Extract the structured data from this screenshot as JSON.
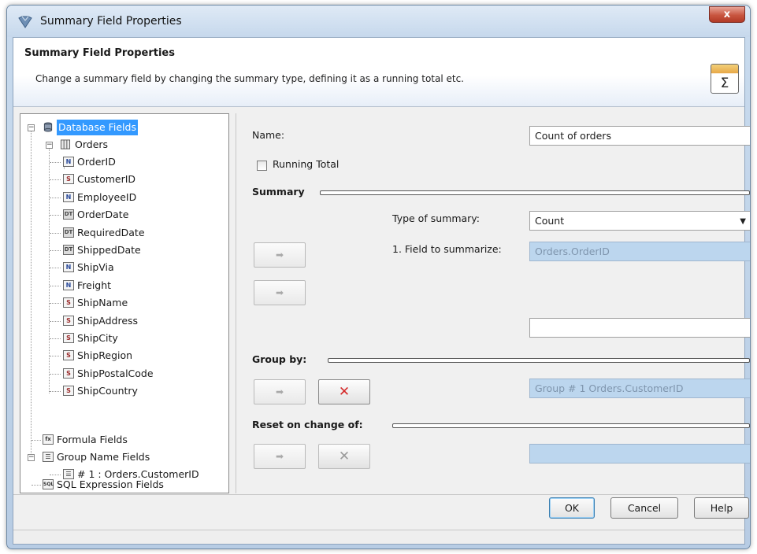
{
  "window": {
    "title": "Summary Field Properties",
    "close_label": "x"
  },
  "header": {
    "title": "Summary Field Properties",
    "description": "Change a summary field by changing the summary type, defining it as a running total etc.",
    "icon": "sigma-icon",
    "icon_glyph": "Σ"
  },
  "tree": {
    "database_fields": "Database Fields",
    "orders": "Orders",
    "fields": [
      {
        "label": "OrderID",
        "type": "N"
      },
      {
        "label": "CustomerID",
        "type": "S"
      },
      {
        "label": "EmployeeID",
        "type": "N"
      },
      {
        "label": "OrderDate",
        "type": "DT"
      },
      {
        "label": "RequiredDate",
        "type": "DT"
      },
      {
        "label": "ShippedDate",
        "type": "DT"
      },
      {
        "label": "ShipVia",
        "type": "N"
      },
      {
        "label": "Freight",
        "type": "N"
      },
      {
        "label": "ShipName",
        "type": "S"
      },
      {
        "label": "ShipAddress",
        "type": "S"
      },
      {
        "label": "ShipCity",
        "type": "S"
      },
      {
        "label": "ShipRegion",
        "type": "S"
      },
      {
        "label": "ShipPostalCode",
        "type": "S"
      },
      {
        "label": "ShipCountry",
        "type": "S"
      }
    ],
    "formula_fields": "Formula Fields",
    "group_name_fields": "Group Name Fields",
    "group_item": "# 1 : Orders.CustomerID",
    "sql_expression_fields": "SQL Expression Fields"
  },
  "form": {
    "name_label": "Name:",
    "name_value": "Count of orders",
    "running_total_label": "Running Total",
    "running_total_checked": false,
    "summary_title": "Summary",
    "type_of_summary_label": "Type of summary:",
    "type_of_summary_value": "Count",
    "field_to_summarize_label": "1. Field to summarize:",
    "field_to_summarize_value": "Orders.OrderID",
    "extra_field_value": "",
    "group_by_title": "Group by:",
    "group_by_value": "Group # 1 Orders.CustomerID",
    "reset_title": "Reset on change of:",
    "reset_value": "",
    "arrow_glyph": "➡",
    "x_glyph": "✕"
  },
  "buttons": {
    "ok": "OK",
    "cancel": "Cancel",
    "help": "Help"
  },
  "colors": {
    "selection": "#3399ff",
    "disabled_field": "#bcd6ee",
    "close_button": "#c8553f"
  }
}
